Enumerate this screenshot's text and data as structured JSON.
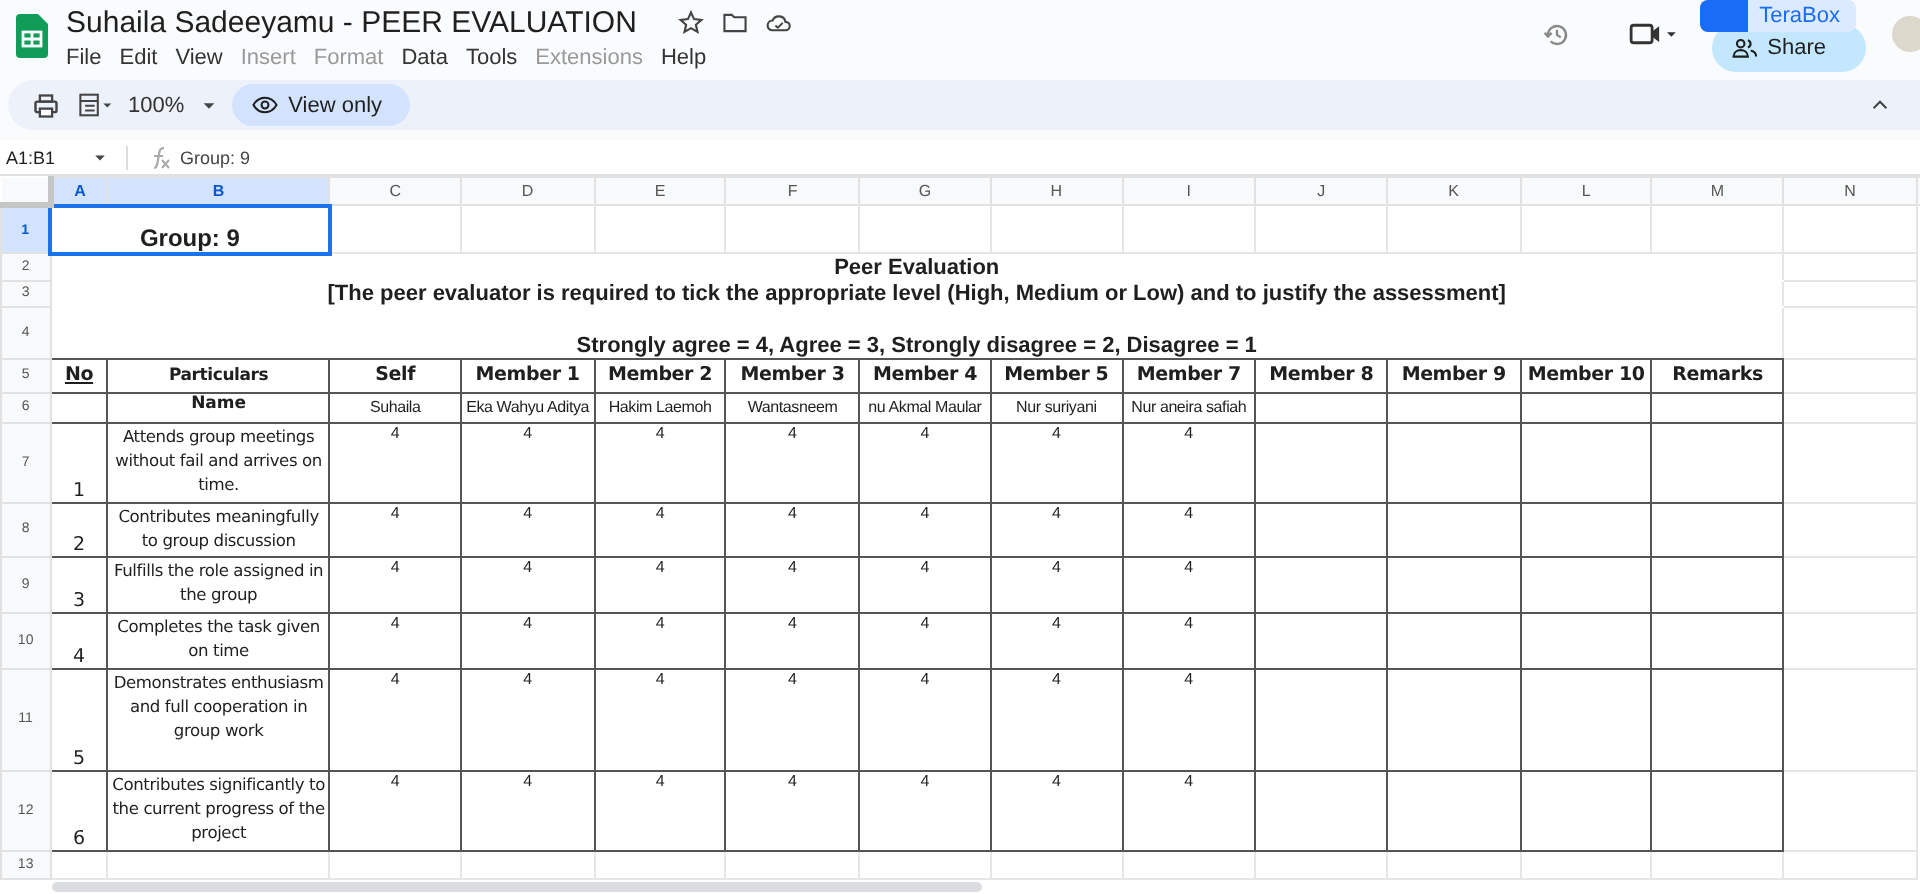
{
  "document": {
    "title": "Suhaila Sadeeyamu - PEER EVALUATION"
  },
  "menus": [
    {
      "label": "File",
      "disabled": false
    },
    {
      "label": "Edit",
      "disabled": false
    },
    {
      "label": "View",
      "disabled": false
    },
    {
      "label": "Insert",
      "disabled": true
    },
    {
      "label": "Format",
      "disabled": true
    },
    {
      "label": "Data",
      "disabled": false
    },
    {
      "label": "Tools",
      "disabled": false
    },
    {
      "label": "Extensions",
      "disabled": true
    },
    {
      "label": "Help",
      "disabled": false
    }
  ],
  "terabox": "TeraBox",
  "share": "Share",
  "toolbar": {
    "zoom": "100%",
    "view_only": "View only"
  },
  "formula_bar": {
    "name_box": "A1:B1",
    "formula": "Group: 9"
  },
  "column_headers": [
    {
      "label": "A",
      "selected": true
    },
    {
      "label": "B",
      "selected": true
    },
    {
      "label": "C",
      "selected": false
    },
    {
      "label": "D",
      "selected": false
    },
    {
      "label": "E",
      "selected": false
    },
    {
      "label": "F",
      "selected": false
    },
    {
      "label": "G",
      "selected": false
    },
    {
      "label": "H",
      "selected": false
    },
    {
      "label": "I",
      "selected": false
    },
    {
      "label": "J",
      "selected": false
    },
    {
      "label": "K",
      "selected": false
    },
    {
      "label": "L",
      "selected": false
    },
    {
      "label": "M",
      "selected": false
    },
    {
      "label": "N",
      "selected": false
    }
  ],
  "row_numbers": [
    {
      "label": "1",
      "selected": true
    },
    {
      "label": "2",
      "selected": false
    },
    {
      "label": "3",
      "selected": false
    },
    {
      "label": "4",
      "selected": false
    },
    {
      "label": "5",
      "selected": false
    },
    {
      "label": "6",
      "selected": false
    },
    {
      "label": "7",
      "selected": false
    },
    {
      "label": "8",
      "selected": false
    },
    {
      "label": "9",
      "selected": false
    },
    {
      "label": "10",
      "selected": false
    },
    {
      "label": "11",
      "selected": false
    },
    {
      "label": "12",
      "selected": false
    },
    {
      "label": "13",
      "selected": false
    }
  ],
  "sheet": {
    "group": "Group: 9",
    "heading": "Peer Evaluation",
    "instruction": "[The peer evaluator is required to tick the appropriate level (High, Medium or Low) and to justify the assessment]",
    "scale": "Strongly agree = 4, Agree = 3, Strongly disagree = 2, Disagree = 1",
    "columns": [
      "No",
      "Particulars",
      "Self",
      "Member 1",
      "Member 2",
      "Member 3",
      "Member 4",
      "Member 5",
      "Member 7",
      "Member 8",
      "Member 9",
      "Member 10",
      "Remarks"
    ],
    "name_label": "Name",
    "names": [
      "Suhaila",
      "Eka Wahyu Aditya",
      "Hakim Laemoh",
      "Wantasneem",
      "nu Akmal Maular",
      "Nur suriyani",
      "Nur aneira safiah"
    ],
    "items": [
      {
        "no": "1",
        "text": "Attends group meetings without fail and arrives on time.",
        "scores": [
          "4",
          "4",
          "4",
          "4",
          "4",
          "4",
          "4"
        ]
      },
      {
        "no": "2",
        "text": "Contributes meaningfully to group discussion",
        "scores": [
          "4",
          "4",
          "4",
          "4",
          "4",
          "4",
          "4"
        ]
      },
      {
        "no": "3",
        "text": "Fulfills the role assigned in the group",
        "scores": [
          "4",
          "4",
          "4",
          "4",
          "4",
          "4",
          "4"
        ]
      },
      {
        "no": "4",
        "text": "Completes the task given on time",
        "scores": [
          "4",
          "4",
          "4",
          "4",
          "4",
          "4",
          "4"
        ]
      },
      {
        "no": "5",
        "text": "Demonstrates enthusiasm and full cooperation in group work",
        "scores": [
          "4",
          "4",
          "4",
          "4",
          "4",
          "4",
          "4"
        ]
      },
      {
        "no": "6",
        "text": "Contributes significantly to the current progress of the project",
        "scores": [
          "4",
          "4",
          "4",
          "4",
          "4",
          "4",
          "4"
        ]
      }
    ]
  }
}
